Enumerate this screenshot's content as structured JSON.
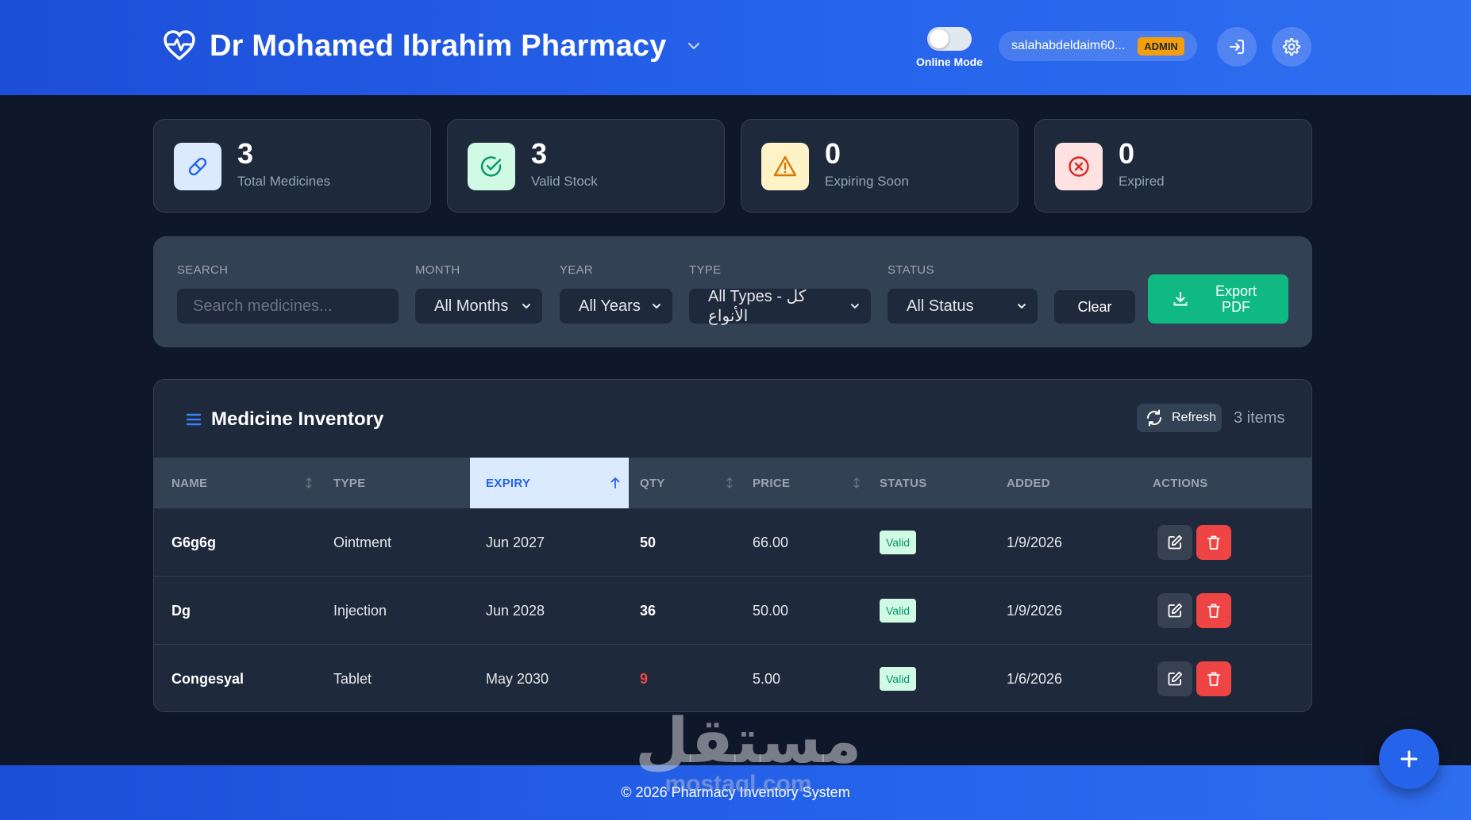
{
  "header": {
    "title": "Dr Mohamed Ibrahim Pharmacy",
    "online_mode_label": "Online Mode",
    "user_email": "salahabdeldaim60...",
    "user_role": "ADMIN"
  },
  "stats": [
    {
      "value": "3",
      "label": "Total Medicines",
      "icon": "pill-icon",
      "color": "#2563eb"
    },
    {
      "value": "3",
      "label": "Valid Stock",
      "icon": "check-circle-icon",
      "color": "#059669"
    },
    {
      "value": "0",
      "label": "Expiring Soon",
      "icon": "warning-icon",
      "color": "#d97706"
    },
    {
      "value": "0",
      "label": "Expired",
      "icon": "x-circle-icon",
      "color": "#dc2626"
    }
  ],
  "filters": {
    "search_label": "SEARCH",
    "search_placeholder": "Search medicines...",
    "month_label": "MONTH",
    "month_value": "All Months",
    "year_label": "YEAR",
    "year_value": "All Years",
    "type_label": "TYPE",
    "type_value": "All Types - كل الأنواع",
    "status_label": "STATUS",
    "status_value": "All Status",
    "clear_label": "Clear",
    "export_label": "Export PDF"
  },
  "inventory": {
    "title": "Medicine Inventory",
    "refresh_label": "Refresh",
    "items_count": "3 items",
    "columns": [
      "NAME",
      "TYPE",
      "EXPIRY",
      "QTY",
      "PRICE",
      "STATUS",
      "ADDED",
      "ACTIONS"
    ],
    "sorted_column": "EXPIRY",
    "rows": [
      {
        "name": "G6g6g",
        "type": "Ointment",
        "expiry": "Jun 2027",
        "qty": "50",
        "price": "66.00",
        "status": "Valid",
        "added": "1/9/2026"
      },
      {
        "name": "Dg",
        "type": "Injection",
        "expiry": "Jun 2028",
        "qty": "36",
        "price": "50.00",
        "status": "Valid",
        "added": "1/9/2026"
      },
      {
        "name": "Congesyal",
        "type": "Tablet",
        "expiry": "May 2030",
        "qty": "9",
        "price": "5.00",
        "status": "Valid",
        "added": "1/6/2026"
      }
    ]
  },
  "footer": {
    "text": "© 2026 Pharmacy Inventory System"
  },
  "watermark": {
    "text": "مستقل",
    "subtext": "mostaql.com"
  },
  "colors": {
    "accent": "#2563eb",
    "success": "#10b981",
    "danger": "#ef4444",
    "warning": "#f59e0b"
  }
}
